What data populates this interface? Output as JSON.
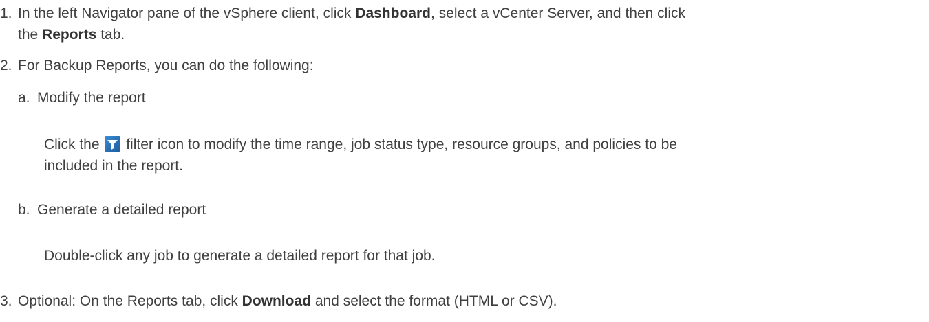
{
  "steps": [
    {
      "number": "1.",
      "line1_pre": "In the left Navigator pane of the vSphere client, click ",
      "line1_bold": "Dashboard",
      "line1_post": ", select a vCenter Server, and then click",
      "line2_pre": "the ",
      "line2_bold": "Reports",
      "line2_post": " tab."
    },
    {
      "number": "2.",
      "text": "For Backup Reports, you can do the following:",
      "substeps": [
        {
          "letter": "a.",
          "title": "Modify the report",
          "para_pre": "Click the ",
          "icon": "filter-icon",
          "para_line1_post": " filter icon to modify the time range, job status type, resource groups, and policies to be",
          "para_line2": "included in the report."
        },
        {
          "letter": "b.",
          "title": "Generate a detailed report",
          "para": "Double-click any job to generate a detailed report for that job."
        }
      ]
    },
    {
      "number": "3.",
      "pre": "Optional: On the Reports tab, click ",
      "bold": "Download",
      "post": " and select the format (HTML or CSV)."
    }
  ]
}
